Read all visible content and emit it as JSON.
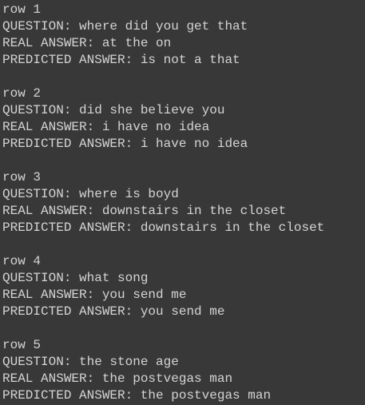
{
  "rows": [
    {
      "header": "row 1",
      "question": "QUESTION: where did you get that",
      "real": "REAL ANSWER: at the on",
      "predicted": "PREDICTED ANSWER: is not a that"
    },
    {
      "header": "row 2",
      "question": "QUESTION: did she believe you",
      "real": "REAL ANSWER: i have no idea",
      "predicted": "PREDICTED ANSWER: i have no idea"
    },
    {
      "header": "row 3",
      "question": "QUESTION: where is boyd",
      "real": "REAL ANSWER: downstairs in the closet",
      "predicted": "PREDICTED ANSWER: downstairs in the closet"
    },
    {
      "header": "row 4",
      "question": "QUESTION: what song",
      "real": "REAL ANSWER: you send me",
      "predicted": "PREDICTED ANSWER: you send me"
    },
    {
      "header": "row 5",
      "question": "QUESTION: the stone age",
      "real": "REAL ANSWER: the postvegas man",
      "predicted": "PREDICTED ANSWER: the postvegas man"
    }
  ]
}
